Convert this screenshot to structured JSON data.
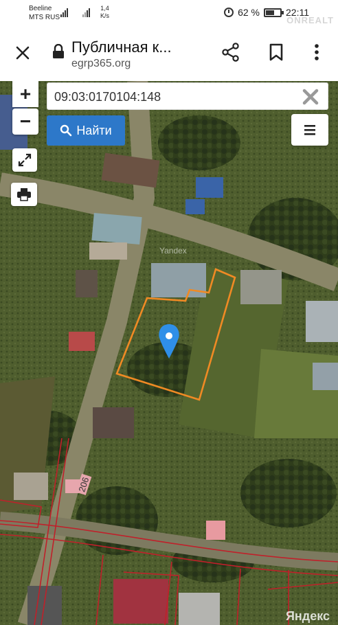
{
  "status_bar": {
    "carrier_line1": "Beeline",
    "carrier_line2": "MTS RUS",
    "net_speed": "1,4",
    "net_speed_unit": "K/s",
    "battery_percent": "62 %",
    "battery_level": 0.62,
    "time": "22:11",
    "watermark": "ONREALT"
  },
  "toolbar": {
    "title": "Публичная к...",
    "url": "egrp365.org",
    "icons": [
      "close-icon",
      "lock-icon",
      "share-icon",
      "bookmark-icon",
      "more-vert-icon"
    ]
  },
  "map": {
    "search_value": "09:03:0170104:148",
    "find_label": "Найти",
    "watermark_top": "Yandex",
    "watermark_bottom": "Яндекс",
    "road_number": "206",
    "zoom_in_label": "+",
    "zoom_out_label": "−",
    "controls": [
      "zoom-in",
      "zoom-out",
      "fullscreen-icon",
      "print-icon",
      "menu-icon",
      "search-icon",
      "clear-icon"
    ],
    "parcel_outline_color": "#f08a24",
    "pin_color": "#2f8fe8",
    "cadastre_line_color": "#c0202a"
  }
}
